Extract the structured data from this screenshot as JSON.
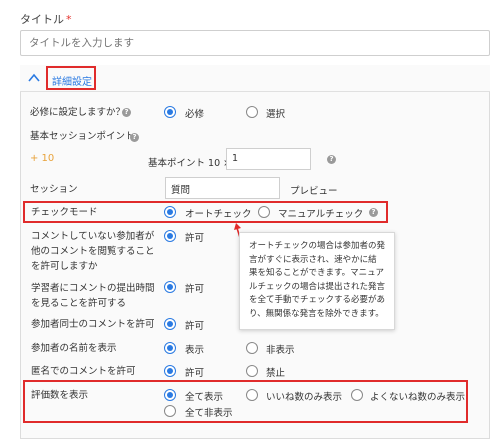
{
  "title_field": {
    "label": "タイトル",
    "required_mark": "*",
    "placeholder": "タイトルを入力します"
  },
  "advanced": {
    "label": "詳細設定"
  },
  "must_setting": {
    "label": "必修に設定しますか？",
    "options": [
      "必修",
      "選択"
    ],
    "selected": 0
  },
  "base_points": {
    "label": "基本セッションポイント",
    "bonus": "+ 10",
    "formula_label": "基本ポイント 10 ×",
    "value": "1"
  },
  "session": {
    "label": "セッション",
    "value": "質問",
    "preview": "プレビュー"
  },
  "check_mode": {
    "label": "チェックモード",
    "options": [
      "オートチェック",
      "マニュアルチェック"
    ],
    "selected": 0
  },
  "view_others": {
    "label": "コメントしていない参加者が他のコメントを閲覧することを許可しますか",
    "option": "許可"
  },
  "time_limit": {
    "label": "学習者にコメントの提出時間を見ることを許可する",
    "option": "許可"
  },
  "peer_comment": {
    "label": "参加者同士のコメントを許可",
    "option": "許可"
  },
  "show_names": {
    "label": "参加者の名前を表示",
    "options": [
      "表示",
      "非表示"
    ],
    "selected": 0
  },
  "anonymous": {
    "label": "匿名でのコメントを許可",
    "options": [
      "許可",
      "禁止"
    ],
    "selected": 0
  },
  "rating_display": {
    "label": "評価数を表示",
    "options": [
      "全て表示",
      "いいね数のみ表示",
      "よくないね数のみ表示",
      "全て非表示"
    ],
    "selected": 0
  },
  "tooltip": {
    "text": "オートチェックの場合は参加者の発言がすぐに表示され、速やかに結果を知ることができます。マニュアルチェックの場合は提出された発言を全て手動でチェックする必要があり、無関係な発言を除外できます。"
  },
  "colors": {
    "accent": "#2a7ae2",
    "annotation_red": "#e02b2b",
    "required": "#e5322d"
  },
  "icons": {
    "collapse": "chevron-up-icon",
    "help": "help-icon",
    "arrow": "annotation-arrow"
  }
}
